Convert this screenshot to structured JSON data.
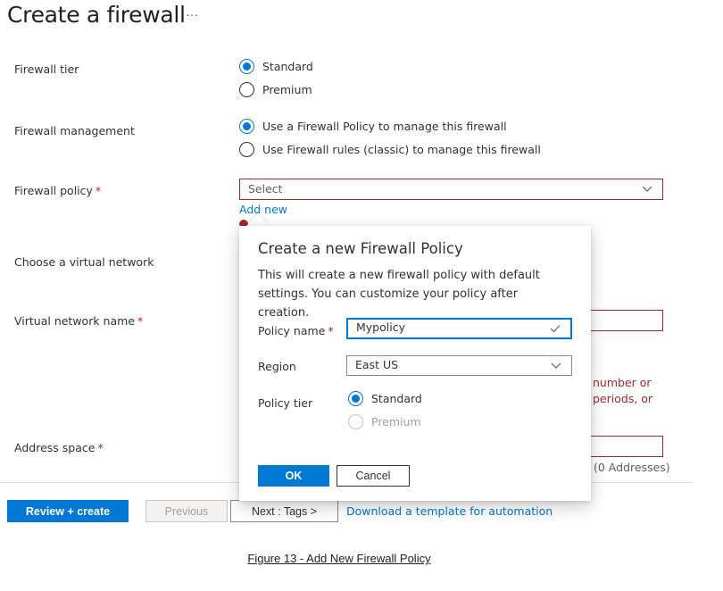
{
  "page": {
    "title": "Create a firewall",
    "more_label": "···"
  },
  "form": {
    "firewall_tier": {
      "label": "Firewall tier",
      "options": [
        {
          "label": "Standard",
          "selected": true
        },
        {
          "label": "Premium",
          "selected": false
        }
      ]
    },
    "firewall_management": {
      "label": "Firewall management",
      "options": [
        {
          "label": "Use a Firewall Policy to manage this firewall",
          "selected": true
        },
        {
          "label": "Use Firewall rules (classic) to manage this firewall",
          "selected": false
        }
      ]
    },
    "firewall_policy": {
      "label": "Firewall policy",
      "required_mark": "*",
      "placeholder": "Select",
      "add_new_label": "Add new"
    },
    "virtual_network": {
      "label": "Choose a virtual network"
    },
    "virtual_network_name": {
      "label": "Virtual network name",
      "required_mark": "*",
      "error_partial_line1": "number or",
      "error_partial_line2": "periods, or"
    },
    "address_space": {
      "label": "Address space",
      "required_mark": "*",
      "count_text": "(0 Addresses)"
    }
  },
  "popup": {
    "title": "Create a new Firewall Policy",
    "description": "This will create a new firewall policy with default settings. You can customize your policy after creation.",
    "policy_name": {
      "label": "Policy name",
      "required_mark": "*",
      "value": "Mypolicy"
    },
    "region": {
      "label": "Region",
      "value": "East US"
    },
    "policy_tier": {
      "label": "Policy tier",
      "options": [
        {
          "label": "Standard",
          "selected": true,
          "disabled": false
        },
        {
          "label": "Premium",
          "selected": false,
          "disabled": true
        }
      ]
    },
    "ok_label": "OK",
    "cancel_label": "Cancel"
  },
  "footer": {
    "review_create_label": "Review + create",
    "previous_label": "Previous",
    "next_label": "Next : Tags >",
    "download_template_label": "Download a template for automation"
  },
  "caption": "Figure 13 - Add New Firewall Policy",
  "colors": {
    "accent": "#0078d4",
    "error": "#a4262c"
  }
}
